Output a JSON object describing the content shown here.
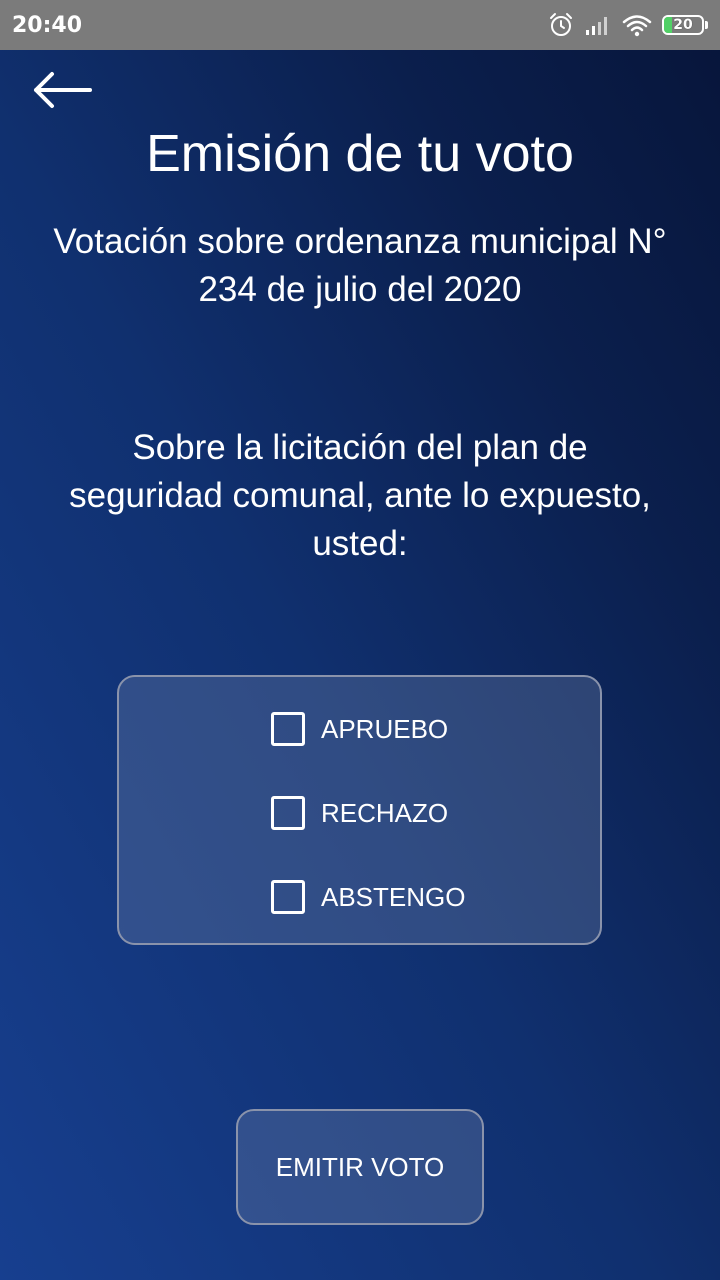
{
  "status_bar": {
    "time": "20:40",
    "icons": [
      "alarm-icon",
      "signal-icon",
      "wifi-icon",
      "battery-icon"
    ],
    "battery_level": "20"
  },
  "header": {
    "back_icon": "arrow-left-icon",
    "title": "Emisión de tu voto"
  },
  "vote": {
    "subtitle": "Votación sobre ordenanza municipal N° 234 de julio del 2020",
    "question": "Sobre la licitación del plan de seguridad comunal, ante lo expuesto, usted:",
    "options": [
      {
        "label": "APRUEBO",
        "checked": false
      },
      {
        "label": "RECHAZO",
        "checked": false
      },
      {
        "label": "ABSTENGO",
        "checked": false
      }
    ],
    "submit_label": "EMITIR VOTO"
  },
  "colors": {
    "gradient_top": "#07153a",
    "gradient_bottom": "#173f8f",
    "status_bar": "#7b7b7b",
    "box_border": "#8a93ab",
    "battery_fill": "#4cd964"
  }
}
